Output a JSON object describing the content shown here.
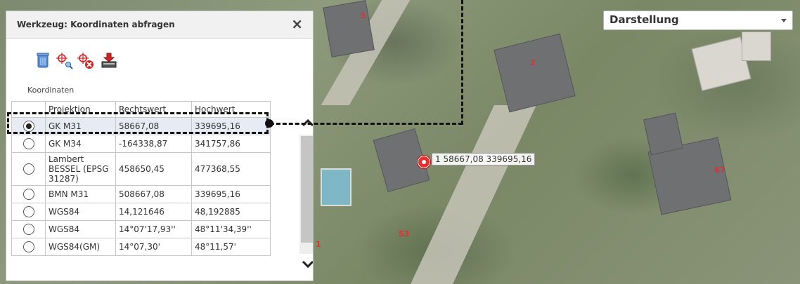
{
  "map": {
    "lot_numbers": [
      "3",
      "2",
      "67",
      "53",
      "1"
    ],
    "marker_label": "1  58667,08 339695,16"
  },
  "dropdown": {
    "label": "Darstellung"
  },
  "panel": {
    "title": "Werkzeug: Koordinaten abfragen",
    "close_icon": "×",
    "tools": [
      "delete-icon",
      "query-point-icon",
      "remove-point-icon",
      "export-icon"
    ],
    "section_label": "Koordinaten",
    "columns": [
      "Projektion",
      "Rechtswert",
      "Hochwert"
    ],
    "rows": [
      {
        "projektion": "GK M31",
        "rechtswert": "58667,08",
        "hochwert": "339695,16",
        "selected": true
      },
      {
        "projektion": "GK M34",
        "rechtswert": "-164338,87",
        "hochwert": "341757,86",
        "selected": false
      },
      {
        "projektion": "Lambert BESSEL (EPSG 31287)",
        "rechtswert": "458650,45",
        "hochwert": "477368,55",
        "selected": false
      },
      {
        "projektion": "BMN M31",
        "rechtswert": "508667,08",
        "hochwert": "339695,16",
        "selected": false
      },
      {
        "projektion": "WGS84",
        "rechtswert": "14,121646",
        "hochwert": "48,192885",
        "selected": false
      },
      {
        "projektion": "WGS84",
        "rechtswert": "14°07'17,93''",
        "hochwert": "48°11'34,39''",
        "selected": false
      },
      {
        "projektion": "WGS84(GM)",
        "rechtswert": "14°07,30'",
        "hochwert": "48°11,57'",
        "selected": false
      }
    ]
  },
  "colors": {
    "marker": "#e83030",
    "lot_number": "#e03030",
    "selected_row": "#e6ebf4"
  }
}
